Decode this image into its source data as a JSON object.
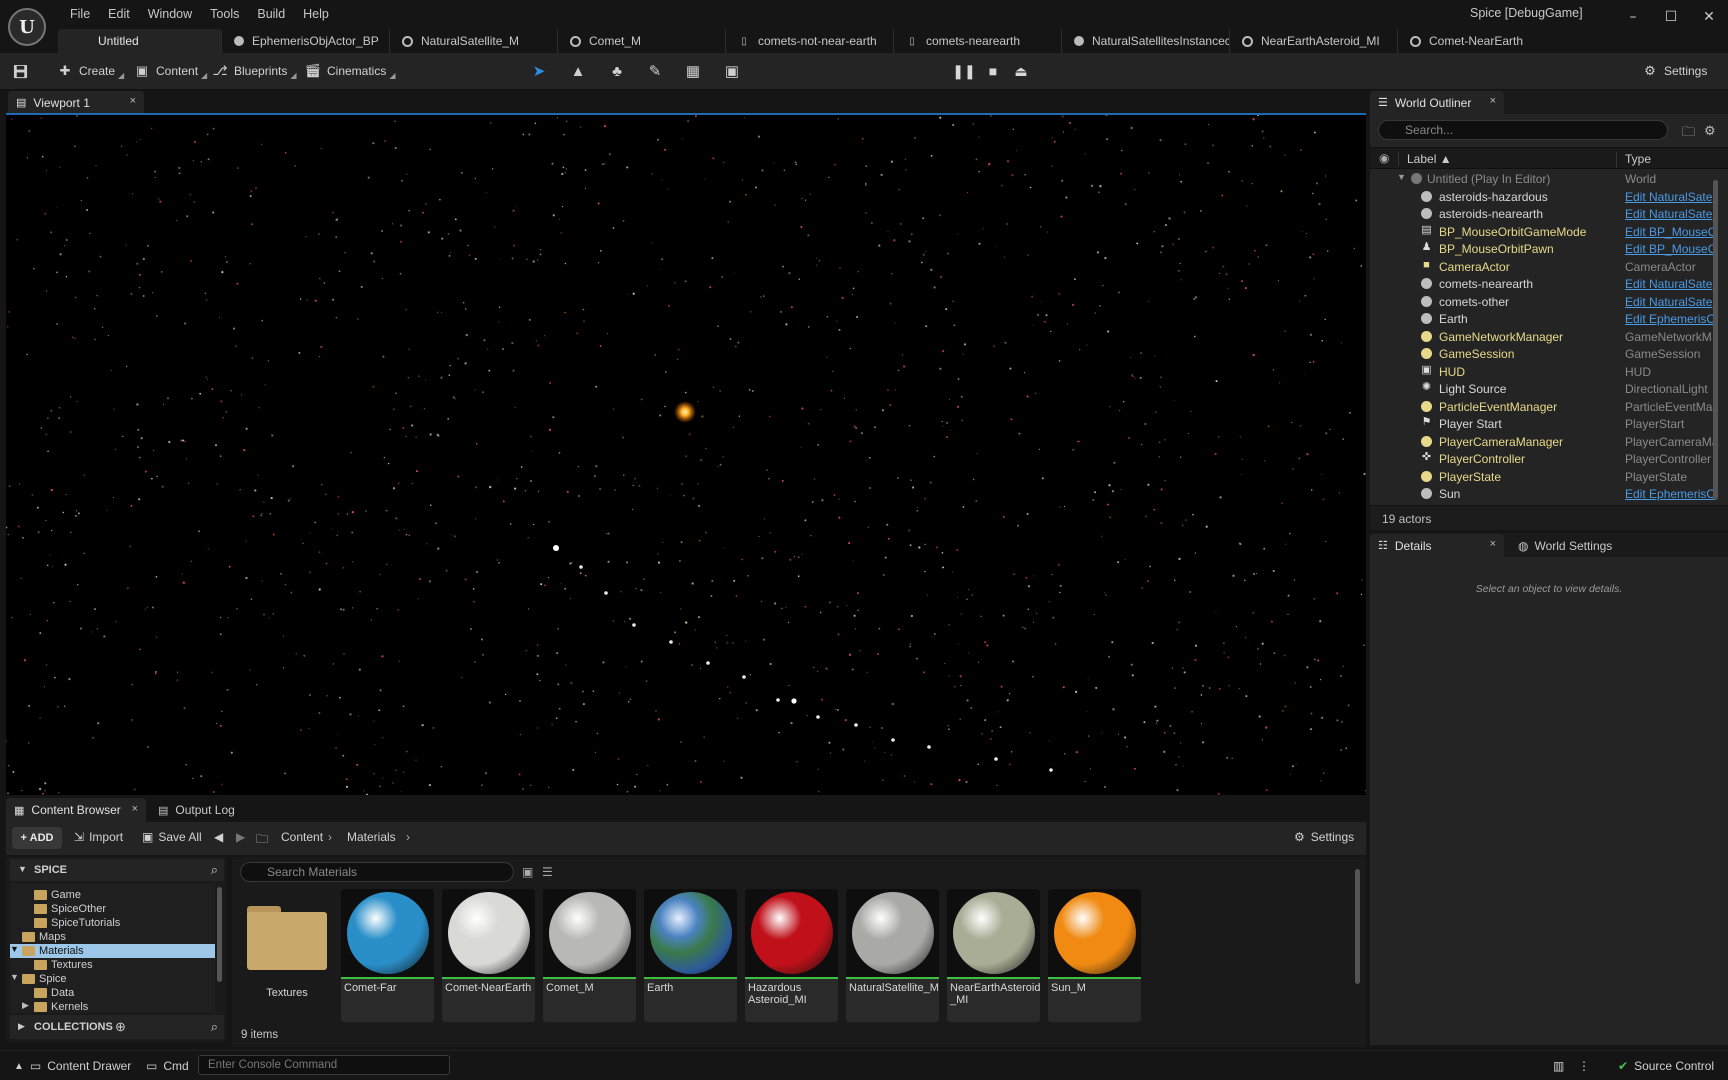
{
  "app": {
    "logo": "U",
    "title": "Spice [DebugGame]",
    "menu": [
      "File",
      "Edit",
      "Window",
      "Tools",
      "Build",
      "Help"
    ],
    "window_controls": {
      "minimize": "–",
      "maximize": "☐",
      "close": "✕"
    }
  },
  "doc_tabs": [
    {
      "label": "Untitled",
      "icon": "none",
      "active": true
    },
    {
      "label": "EphemerisObjActor_BP",
      "icon": "blueprint-icon"
    },
    {
      "label": "NaturalSatellite_M",
      "icon": "material-icon"
    },
    {
      "label": "Comet_M",
      "icon": "material-icon"
    },
    {
      "label": "comets-not-near-earth",
      "icon": "data-table-icon"
    },
    {
      "label": "comets-nearearth",
      "icon": "data-table-icon"
    },
    {
      "label": "NaturalSatellitesInstancec",
      "icon": "blueprint-icon"
    },
    {
      "label": "NearEarthAsteroid_MI",
      "icon": "material-instance-icon"
    },
    {
      "label": "Comet-NearEarth",
      "icon": "material-instance-icon"
    }
  ],
  "toolbar": {
    "save_icon": "save-icon",
    "create": "Create",
    "content": "Content",
    "blueprints": "Blueprints",
    "cinematics": "Cinematics",
    "settings": "Settings"
  },
  "viewport": {
    "tab_label": "Viewport 1",
    "close": "×"
  },
  "outliner": {
    "tab_label": "World Outliner",
    "close": "×",
    "search_placeholder": "Search...",
    "col_label": "Label ▲",
    "col_type": "Type",
    "world_row": {
      "label": "Untitled (Play In Editor)",
      "type": "World"
    },
    "rows": [
      {
        "label": "asteroids-hazardous",
        "type": "Edit NaturalSate",
        "link": true,
        "icon": "sphere"
      },
      {
        "label": "asteroids-nearearth",
        "type": "Edit NaturalSate",
        "link": true,
        "icon": "sphere"
      },
      {
        "label": "BP_MouseOrbitGameMode",
        "type": "Edit BP_MouseO",
        "link": true,
        "icon": "gamemode",
        "yellow": true
      },
      {
        "label": "BP_MouseOrbitPawn",
        "type": "Edit BP_MouseO",
        "link": true,
        "icon": "pawn",
        "yellow": true
      },
      {
        "label": "CameraActor",
        "type": "CameraActor",
        "link": false,
        "icon": "camera",
        "yellow": true
      },
      {
        "label": "comets-nearearth",
        "type": "Edit NaturalSate",
        "link": true,
        "icon": "sphere"
      },
      {
        "label": "comets-other",
        "type": "Edit NaturalSate",
        "link": true,
        "icon": "sphere"
      },
      {
        "label": "Earth",
        "type": "Edit EphemerisO",
        "link": true,
        "icon": "sphere"
      },
      {
        "label": "GameNetworkManager",
        "type": "GameNetworkM",
        "link": false,
        "icon": "yellow",
        "yellow": true
      },
      {
        "label": "GameSession",
        "type": "GameSession",
        "link": false,
        "icon": "yellow",
        "yellow": true
      },
      {
        "label": "HUD",
        "type": "HUD",
        "link": false,
        "icon": "hud",
        "yellow": true
      },
      {
        "label": "Light Source",
        "type": "DirectionalLight",
        "link": false,
        "icon": "light"
      },
      {
        "label": "ParticleEventManager",
        "type": "ParticleEventMa",
        "link": false,
        "icon": "yellow",
        "yellow": true
      },
      {
        "label": "Player Start",
        "type": "PlayerStart",
        "link": false,
        "icon": "flag"
      },
      {
        "label": "PlayerCameraManager",
        "type": "PlayerCameraMa",
        "link": false,
        "icon": "yellow",
        "yellow": true
      },
      {
        "label": "PlayerController",
        "type": "PlayerController",
        "link": false,
        "icon": "gamepad",
        "yellow": true
      },
      {
        "label": "PlayerState",
        "type": "PlayerState",
        "link": false,
        "icon": "yellow",
        "yellow": true
      },
      {
        "label": "Sun",
        "type": "Edit EphemerisO",
        "link": true,
        "icon": "sphere"
      }
    ],
    "count": "19 actors"
  },
  "details": {
    "tab_label": "Details",
    "close": "×",
    "world_settings": "World Settings",
    "empty_msg": "Select an object to view details."
  },
  "content_browser": {
    "tab_label": "Content Browser",
    "close": "×",
    "output_log": "Output Log",
    "add": "+ ADD",
    "import": "Import",
    "save_all": "Save All",
    "path": [
      "Content",
      "Materials"
    ],
    "settings": "Settings",
    "tree_header": "SPICE",
    "tree": [
      {
        "label": "Game",
        "indent": 1,
        "folder": true
      },
      {
        "label": "SpiceOther",
        "indent": 1,
        "folder": true
      },
      {
        "label": "SpiceTutorials",
        "indent": 1,
        "folder": true
      },
      {
        "label": "Maps",
        "indent": 0,
        "folder": true
      },
      {
        "label": "Materials",
        "indent": 0,
        "folder": true,
        "selected": true,
        "expanded": true
      },
      {
        "label": "Textures",
        "indent": 1,
        "folder": true
      },
      {
        "label": "Spice",
        "indent": 0,
        "folder": true,
        "expanded": true
      },
      {
        "label": "Data",
        "indent": 1,
        "folder": true
      },
      {
        "label": "Kernels",
        "indent": 1,
        "folder": true,
        "collapsed": true
      }
    ],
    "collections": "COLLECTIONS",
    "search_placeholder": "Search Materials",
    "assets": [
      {
        "label": "Textures",
        "kind": "folder"
      },
      {
        "label": "Comet-Far",
        "kind": "material",
        "color": "#2a8fc9"
      },
      {
        "label": "Comet-NearEarth",
        "kind": "material",
        "color": "#d9d9d6"
      },
      {
        "label": "Comet_M",
        "kind": "material",
        "color": "#b8b8b4"
      },
      {
        "label": "Earth",
        "kind": "material",
        "color": "#3a6fa8"
      },
      {
        "label": "Hazardous Asteroid_MI",
        "kind": "material",
        "color": "#c0111a"
      },
      {
        "label": "NaturalSatellite_M",
        "kind": "material",
        "color": "#a9a9a6"
      },
      {
        "label": "NearEarthAsteroid _MI",
        "kind": "material",
        "color": "#a9ad95"
      },
      {
        "label": "Sun_M",
        "kind": "material",
        "color": "#f08a12"
      }
    ],
    "items_count": "9 items"
  },
  "statusbar": {
    "content_drawer": "Content Drawer",
    "cmd": "Cmd",
    "console_placeholder": "Enter Console Command",
    "source_control": "Source Control"
  }
}
